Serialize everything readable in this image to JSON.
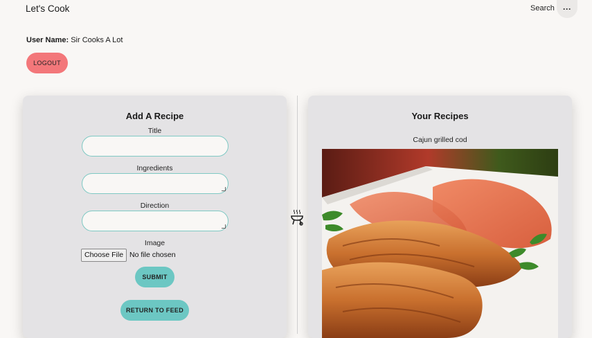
{
  "header": {
    "brand": "Let's Cook",
    "search_label": "Search",
    "more_label": "···"
  },
  "user": {
    "label": "User Name:",
    "name": "Sir Cooks A Lot"
  },
  "logout_label": "LOGOUT",
  "add_recipe": {
    "title": "Add A Recipe",
    "fields": {
      "title_label": "Title",
      "ingredients_label": "Ingredients",
      "direction_label": "Direction",
      "image_label": "Image"
    },
    "file_button": "Choose File",
    "file_status": "No file chosen",
    "submit_label": "SUBMIT",
    "return_label": "RETURN TO FEED"
  },
  "your_recipes": {
    "title": "Your Recipes",
    "items": [
      {
        "name": "Cajun grilled cod"
      }
    ]
  },
  "colors": {
    "background": "#f9f7f5",
    "panel": "#e4e3e5",
    "logout": "#f3777a",
    "teal": "#6cc7c3",
    "input_border": "#7fc9c4"
  },
  "icons": {
    "divider_icon": "grill-icon",
    "more": "more-icon"
  }
}
